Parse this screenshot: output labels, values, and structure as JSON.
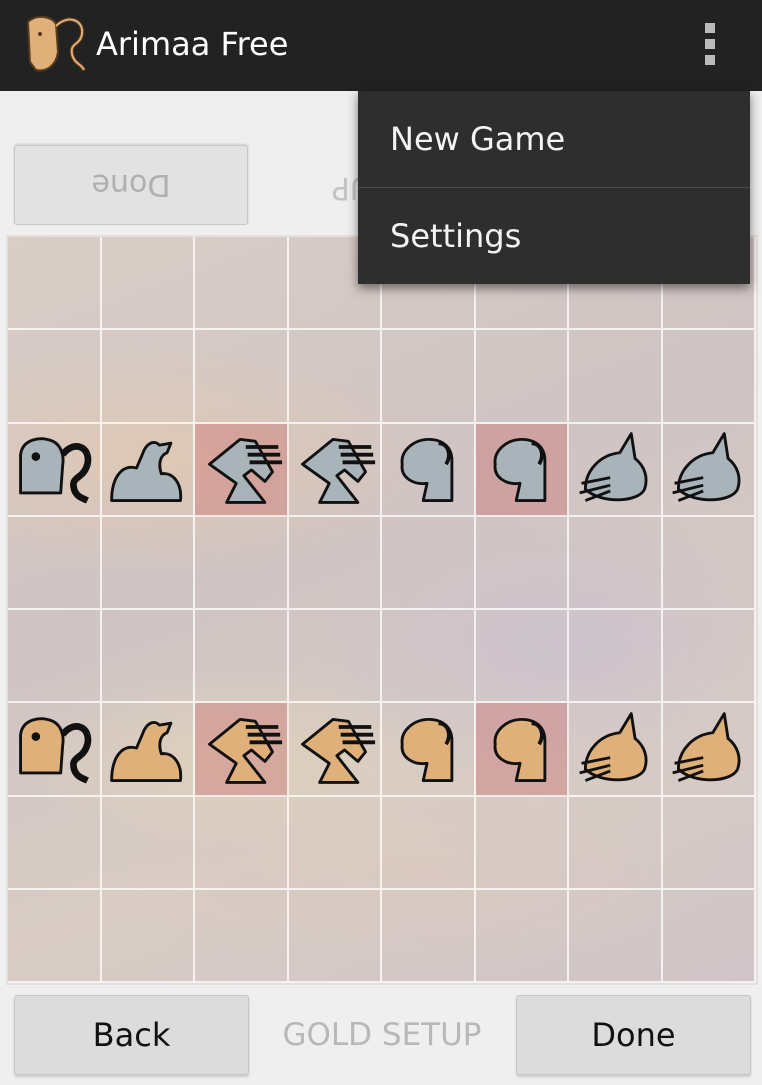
{
  "app": {
    "title": "Arimaa Free",
    "logo_icon": "elephant-logo-icon"
  },
  "toolbar": {
    "overflow_icon": "overflow-menu-icon"
  },
  "opponent_panel": {
    "done_label": "Done",
    "setup_label": "SETUP"
  },
  "menu": {
    "items": [
      {
        "label": "New Game"
      },
      {
        "label": "Settings"
      }
    ]
  },
  "player_panel": {
    "back_label": "Back",
    "setup_label": "GOLD SETUP",
    "done_label": "Done"
  },
  "colors": {
    "silver": "#a9b3ba",
    "gold": "#e0b07a",
    "trap": "#d99a9a"
  },
  "board": {
    "rows": [
      [
        "",
        "",
        "",
        "",
        "",
        "",
        "",
        ""
      ],
      [
        "",
        "",
        "",
        "",
        "",
        "",
        "",
        ""
      ],
      [
        "silver-elephant",
        "silver-camel",
        "silver-horse",
        "silver-horse",
        "silver-dog",
        "silver-dog",
        "silver-cat",
        "silver-cat"
      ],
      [
        "",
        "",
        "",
        "",
        "",
        "",
        "",
        ""
      ],
      [
        "",
        "",
        "",
        "",
        "",
        "",
        "",
        ""
      ],
      [
        "gold-elephant",
        "gold-camel",
        "gold-horse",
        "gold-horse",
        "gold-dog",
        "gold-dog",
        "gold-cat",
        "gold-cat"
      ],
      [
        "",
        "",
        "",
        "",
        "",
        "",
        "",
        ""
      ],
      [
        "",
        "",
        "",
        "",
        "",
        "",
        "",
        ""
      ]
    ],
    "traps": [
      [
        2,
        2
      ],
      [
        2,
        5
      ],
      [
        5,
        2
      ],
      [
        5,
        5
      ]
    ]
  }
}
